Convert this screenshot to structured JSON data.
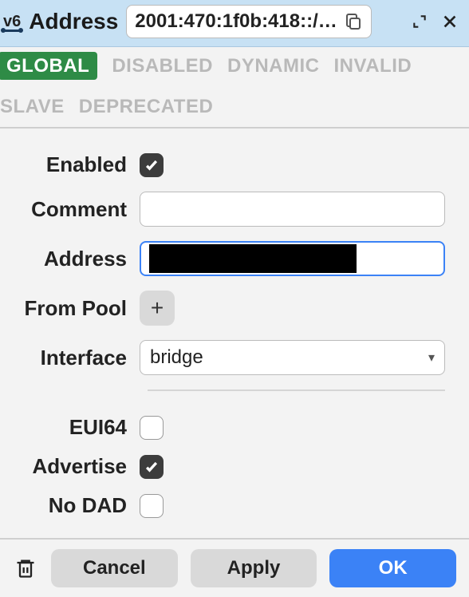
{
  "titlebar": {
    "icon_label": "v6",
    "title": "Address",
    "address_display": "2001:470:1f0b:418::/…"
  },
  "status": {
    "items": [
      {
        "label": "GLOBAL",
        "active": true
      },
      {
        "label": "DISABLED",
        "active": false
      },
      {
        "label": "DYNAMIC",
        "active": false
      },
      {
        "label": "INVALID",
        "active": false
      },
      {
        "label": "SLAVE",
        "active": false
      },
      {
        "label": "DEPRECATED",
        "active": false
      }
    ]
  },
  "form": {
    "enabled": {
      "label": "Enabled",
      "checked": true
    },
    "comment": {
      "label": "Comment",
      "value": ""
    },
    "address": {
      "label": "Address",
      "value": ""
    },
    "from_pool": {
      "label": "From Pool"
    },
    "interface": {
      "label": "Interface",
      "value": "bridge"
    },
    "eui64": {
      "label": "EUI64",
      "checked": false
    },
    "advertise": {
      "label": "Advertise",
      "checked": true
    },
    "no_dad": {
      "label": "No DAD",
      "checked": false
    }
  },
  "footer": {
    "cancel": "Cancel",
    "apply": "Apply",
    "ok": "OK"
  }
}
